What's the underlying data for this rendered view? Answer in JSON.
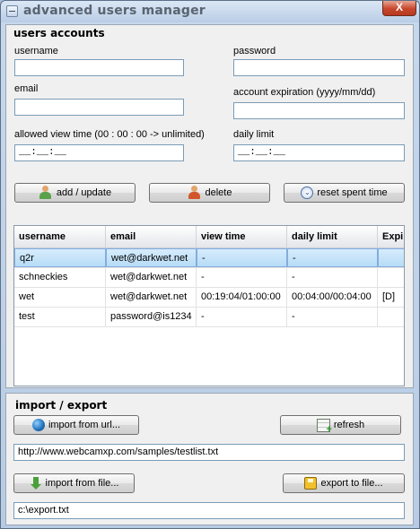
{
  "window": {
    "title": "advanced users manager",
    "close_glyph": "X"
  },
  "accounts": {
    "section_title": "users accounts",
    "username_label": "username",
    "username_value": "",
    "password_label": "password",
    "password_value": "",
    "email_label": "email",
    "email_value": "",
    "expiration_label": "account expiration (yyyy/mm/dd)",
    "expiration_value": "",
    "view_time_label": "allowed view time (00 : 00 : 00 -> unlimited)",
    "view_time_value": "__:__:__",
    "daily_limit_label": "daily limit",
    "daily_limit_value": "__:__:__",
    "add_update_label": "add / update",
    "delete_label": "delete",
    "reset_label": "reset spent time"
  },
  "table": {
    "columns": [
      "username",
      "email",
      "view time",
      "daily limit",
      "Expir"
    ],
    "rows": [
      [
        "q2r",
        "wet@darkwet.net",
        "-",
        "-",
        ""
      ],
      [
        "schneckies",
        "wet@darkwet.net",
        "-",
        "-",
        ""
      ],
      [
        "wet",
        "wet@darkwet.net",
        "00:19:04/01:00:00",
        "00:04:00/00:04:00",
        "[D]"
      ],
      [
        "test",
        "password@is1234",
        "-",
        "-",
        ""
      ]
    ]
  },
  "import_export": {
    "section_title": "import / export",
    "import_url_label": "import from url...",
    "refresh_label": "refresh",
    "url_value": "http://www.webcamxp.com/samples/testlist.txt",
    "import_file_label": "import from file...",
    "export_file_label": "export to file...",
    "file_value": "c:\\export.txt"
  },
  "icons": {
    "add_update": "user-add-icon",
    "delete": "user-delete-icon",
    "reset": "reset-clock-icon",
    "import_url": "globe-icon",
    "refresh": "refresh-grid-icon",
    "import_file": "download-arrow-icon",
    "export_file": "floppy-save-icon"
  }
}
